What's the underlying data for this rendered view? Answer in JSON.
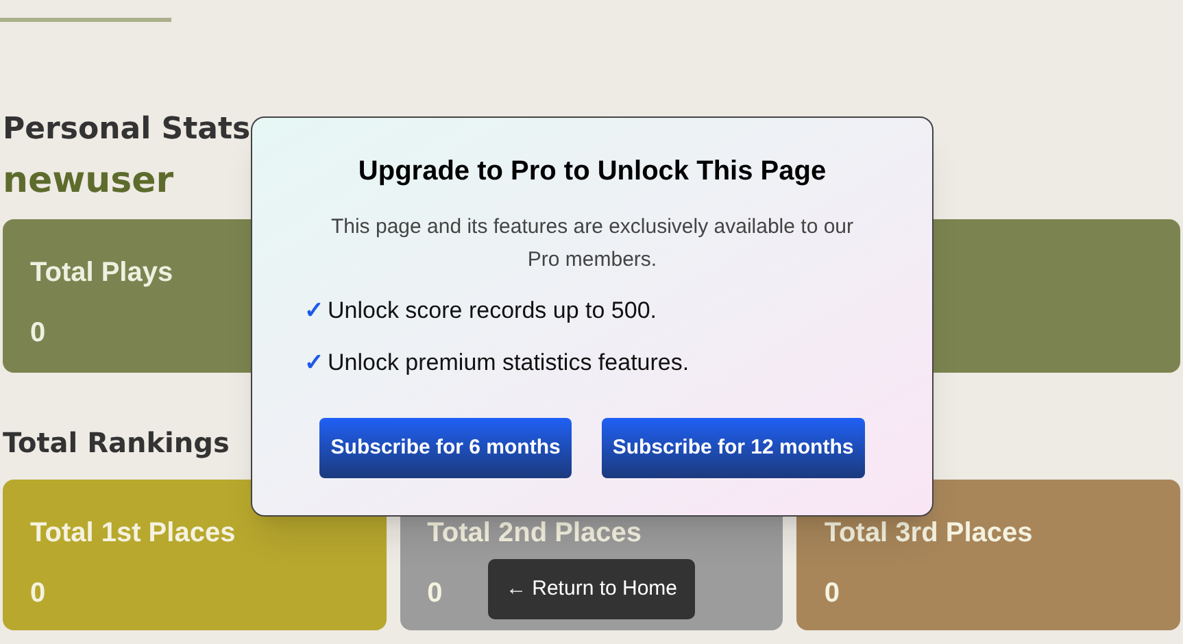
{
  "personal_stats": {
    "heading": "Personal Stats",
    "username": "newuser",
    "cards": [
      {
        "label": "Total Plays",
        "value": "0"
      }
    ]
  },
  "rankings": {
    "heading": "Total Rankings",
    "cards": [
      {
        "label": "Total 1st Places",
        "value": "0",
        "color": "#b8a82e"
      },
      {
        "label": "Total 2nd Places",
        "value": "0",
        "color": "#9c9c9c"
      },
      {
        "label": "Total 3rd Places",
        "value": "0",
        "color": "#a8865a"
      }
    ]
  },
  "modal": {
    "title": "Upgrade to Pro to Unlock This Page",
    "description": "This page and its features are exclusively available to our Pro members.",
    "features": [
      {
        "check": "✓",
        "text": "Unlock score records up to 500."
      },
      {
        "check": "✓",
        "text": "Unlock premium statistics features."
      }
    ],
    "buttons": [
      "Subscribe for 6 months",
      "Subscribe for 12 months"
    ]
  },
  "return_button": "← Return to Home"
}
